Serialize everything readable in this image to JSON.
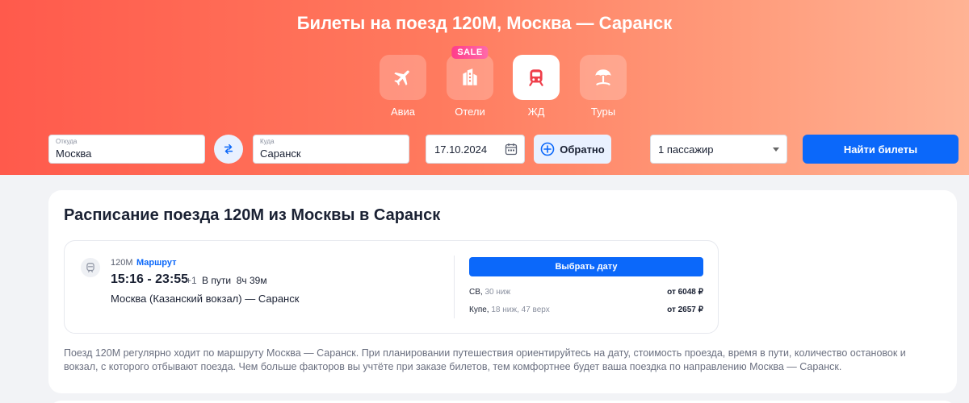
{
  "header": {
    "title": "Билеты на поезд 120М, Москва — Саранск"
  },
  "categories": [
    {
      "label": "Авиа",
      "icon": "plane-icon",
      "active": false
    },
    {
      "label": "Отели",
      "icon": "hotel-icon",
      "active": false,
      "badge": "SALE"
    },
    {
      "label": "ЖД",
      "icon": "train-icon",
      "active": true
    },
    {
      "label": "Туры",
      "icon": "beach-umbrella-icon",
      "active": false
    }
  ],
  "search": {
    "from_label": "Откуда",
    "from_value": "Москва",
    "to_label": "Куда",
    "to_value": "Саранск",
    "date_value": "17.10.2024",
    "return_label": "Обратно",
    "passengers_value": "1 пассажир",
    "submit_label": "Найти билеты"
  },
  "schedule": {
    "title": "Расписание поезда 120М из Москвы в Саранск",
    "train": {
      "number": "120М",
      "route_link": "Маршрут",
      "time": "15:16 - 23:55",
      "day_offset": "+1",
      "duration_label": "В пути",
      "duration": "8ч 39м",
      "stations": "Москва (Казанский вокзал) — Саранск",
      "choose_date_label": "Выбрать дату",
      "seats": [
        {
          "type": "СВ,",
          "details": "30 ниж",
          "price": "от 6048 ₽"
        },
        {
          "type": "Купе,",
          "details": "18 ниж, 47 верх",
          "price": "от 2657 ₽"
        }
      ]
    },
    "description": "Поезд 120М регулярно ходит по маршруту Москва — Саранск. При планировании путешествия ориентируйтесь на дату, стоимость проезда, время в пути, количество остановок и вокзал, с которого отбывают поезда. Чем больше факторов вы учтёте при заказе билетов, тем комфортнее будет ваша поездка по направлению Москва — Саранск."
  },
  "colors": {
    "accent": "#0b68fa",
    "hero_start": "#ff5a4c",
    "hero_end": "#ffb394",
    "active_icon": "#ef3e4a"
  }
}
